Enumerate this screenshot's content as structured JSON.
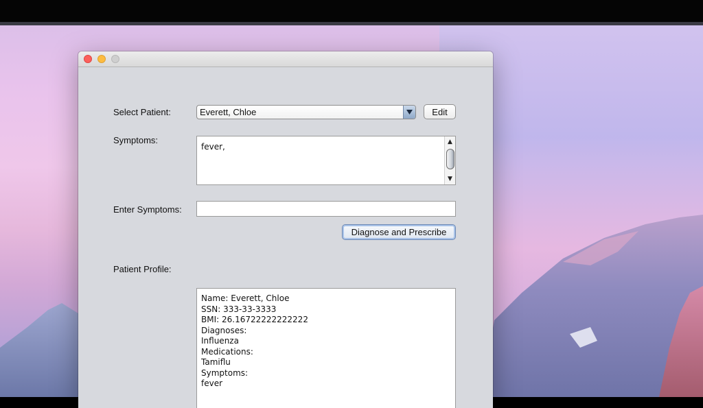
{
  "window": {
    "controls": [
      "close",
      "minimize",
      "zoom"
    ]
  },
  "form": {
    "select_patient_label": "Select Patient:",
    "selected_patient": "Everett, Chloe",
    "edit_button": "Edit",
    "symptoms_label": "Symptoms:",
    "symptoms_value": "fever,",
    "enter_symptoms_label": "Enter Symptoms:",
    "enter_symptoms_value": "",
    "diagnose_button": "Diagnose and Prescribe",
    "patient_profile_label": "Patient Profile:"
  },
  "profile": {
    "lines": [
      "Name: Everett, Chloe",
      "SSN: 333-33-3333",
      "BMI: 26.16722222222222",
      "Diagnoses:",
      "Influenza",
      "Medications:",
      "Tamiflu",
      "Symptoms:",
      "fever"
    ]
  },
  "colors": {
    "close": "#fc605c",
    "minimize": "#fdbc40",
    "zoom": "#cfcfcf",
    "window_bg": "#d7d9de"
  }
}
